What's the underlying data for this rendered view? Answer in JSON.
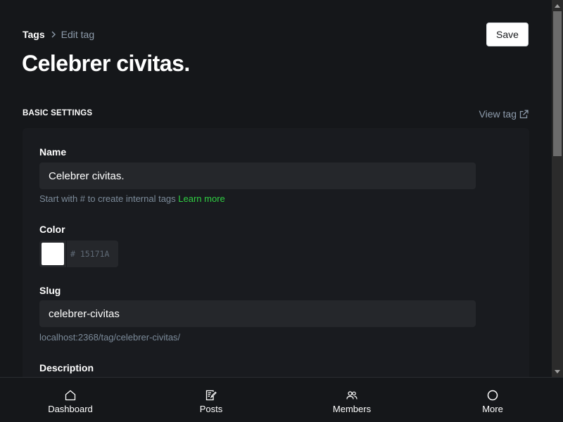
{
  "breadcrumb": {
    "parent": "Tags",
    "current": "Edit tag"
  },
  "header": {
    "title": "Celebrer civitas.",
    "save_label": "Save"
  },
  "section": {
    "title": "BASIC SETTINGS",
    "view_tag_label": "View tag"
  },
  "form": {
    "name": {
      "label": "Name",
      "value": "Celebrer civitas.",
      "hint": "Start with # to create internal tags",
      "hint_link": "Learn more"
    },
    "color": {
      "label": "Color",
      "hex_value": "# 15171A",
      "swatch_color": "#ffffff"
    },
    "slug": {
      "label": "Slug",
      "value": "celebrer-civitas",
      "url_hint": "localhost:2368/tag/celebrer-civitas/"
    },
    "description": {
      "label": "Description"
    }
  },
  "bottom_nav": {
    "items": [
      {
        "label": "Dashboard",
        "icon": "home-icon"
      },
      {
        "label": "Posts",
        "icon": "posts-icon"
      },
      {
        "label": "Members",
        "icon": "members-icon"
      },
      {
        "label": "More",
        "icon": "circle-icon"
      }
    ]
  },
  "colors": {
    "background": "#15171a",
    "card": "#191b1f",
    "input": "#25272b",
    "muted_text": "#8e9cac",
    "accent_green": "#30cf43"
  }
}
